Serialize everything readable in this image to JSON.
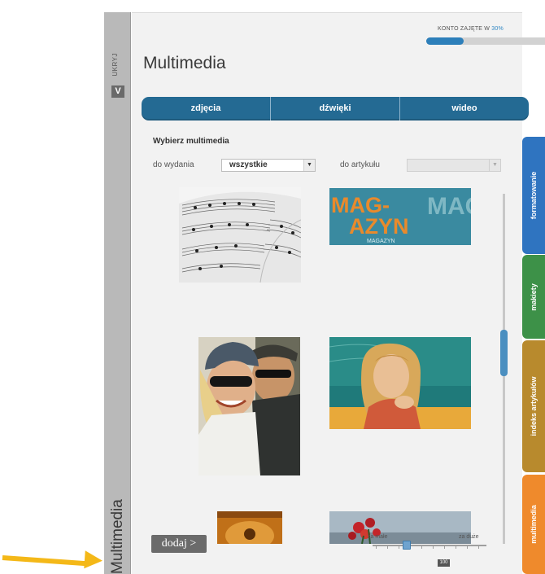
{
  "app": {
    "rail": {
      "hide_label": "UKRYJ",
      "toggle_label": "V",
      "section_label": "Multimedia"
    },
    "quota": {
      "label": "KONTO ZAJĘTE W ",
      "percent_text": "30%",
      "percent_value": 0.3,
      "color": "#2d7fba"
    },
    "title": "Multimedia",
    "tabs": [
      {
        "label": "zdjęcia",
        "active": true
      },
      {
        "label": "dźwięki"
      },
      {
        "label": "wideo"
      }
    ],
    "section_title": "Wybierz multimedia",
    "filters": {
      "edition_label": "do wydania",
      "edition_value": "wszystkie",
      "article_label": "do artykułu",
      "article_value": ""
    },
    "thumbnails": [
      {
        "name": "sheet-music"
      },
      {
        "name": "magazine-logo",
        "text_main": "MAG-",
        "text_main2": "AZYN",
        "text_sub": "MAGAZYN"
      },
      {
        "name": "friends-sunglasses"
      },
      {
        "name": "girl-classroom"
      },
      {
        "name": "guitar"
      },
      {
        "name": "flowers"
      }
    ],
    "add_button_label": "dodaj >",
    "thumb_size": {
      "min_label": "za małe",
      "max_label": "za duże",
      "value_label": "100",
      "position": 0.3
    },
    "side_tabs": [
      {
        "label": "formatowanie",
        "color": "#2f74c0"
      },
      {
        "label": "makiety",
        "color": "#3d9148"
      },
      {
        "label": "indeks artykułów",
        "color": "#b88a2d"
      },
      {
        "label": "multimedia",
        "color": "#ef8a2c"
      }
    ],
    "annotation_color": "#f4b818"
  }
}
